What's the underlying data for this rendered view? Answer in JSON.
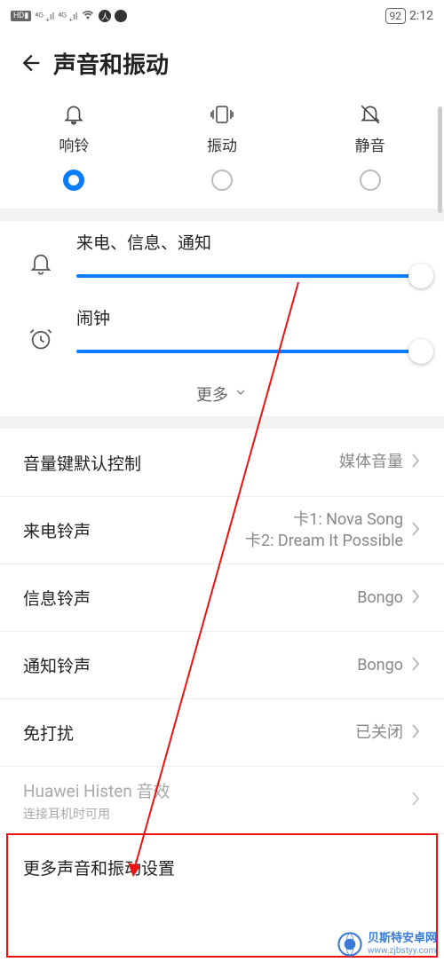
{
  "status_bar": {
    "hd_badge": "HD▮",
    "sig1": "⁴ᴳ ₊ıl",
    "sig2": "⁴ᴳ ₊ıl",
    "wifi": "",
    "icons_right_1": "",
    "icons_right_2": "",
    "battery": "92",
    "time": "2:12"
  },
  "header": {
    "title": "声音和振动"
  },
  "modes": {
    "ring": {
      "label": "响铃"
    },
    "vibrate": {
      "label": "振动"
    },
    "silent": {
      "label": "静音"
    }
  },
  "sliders": {
    "notification": {
      "label": "来电、信息、通知"
    },
    "alarm": {
      "label": "闹钟"
    }
  },
  "expand_label": "更多",
  "rows": {
    "volume_key": {
      "label": "音量键默认控制",
      "value": "媒体音量"
    },
    "ringtone": {
      "label": "来电铃声",
      "value1": "卡1: Nova Song",
      "value2": "卡2: Dream It Possible"
    },
    "message_tone": {
      "label": "信息铃声",
      "value": "Bongo"
    },
    "notification_tone": {
      "label": "通知铃声",
      "value": "Bongo"
    },
    "dnd": {
      "label": "免打扰",
      "value": "已关闭"
    },
    "histen": {
      "label": "Huawei Histen 音效",
      "sub": "连接耳机时可用"
    },
    "more_settings": {
      "label": "更多声音和振动设置"
    }
  },
  "watermark": {
    "line1": "贝斯特安卓网",
    "line2": "www.zjbstyy.com"
  }
}
